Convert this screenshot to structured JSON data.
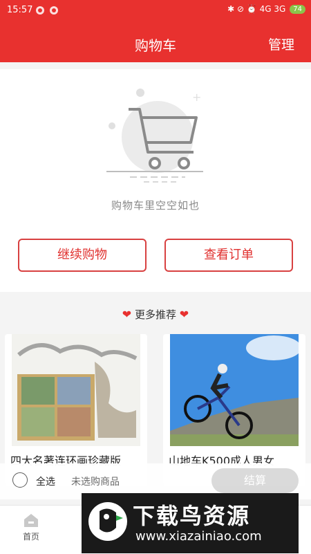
{
  "status_bar": {
    "time": "15:57",
    "icons": "✱ ⊘ ⏰ 4G 3G",
    "battery": "74"
  },
  "header": {
    "title": "购物车",
    "manage_label": "管理"
  },
  "empty_state": {
    "message": "购物车里空空如也",
    "continue_label": "继续购物",
    "orders_label": "查看订单"
  },
  "recommend": {
    "title": "更多推荐",
    "products": [
      {
        "name": "四大名著连环画珍藏版"
      },
      {
        "name": "山地车K500成人男女"
      }
    ]
  },
  "bottom_bar": {
    "select_all": "全选",
    "no_selection": "未选购商品",
    "checkout": "结算"
  },
  "tabbar": {
    "home_label": "首页"
  },
  "watermark": {
    "title": "下载鸟资源",
    "url": "www.xiazainiao.com"
  },
  "colors": {
    "accent": "#e8312f",
    "button_border": "#d84040",
    "checkout_bg": "#d9d9d9"
  }
}
